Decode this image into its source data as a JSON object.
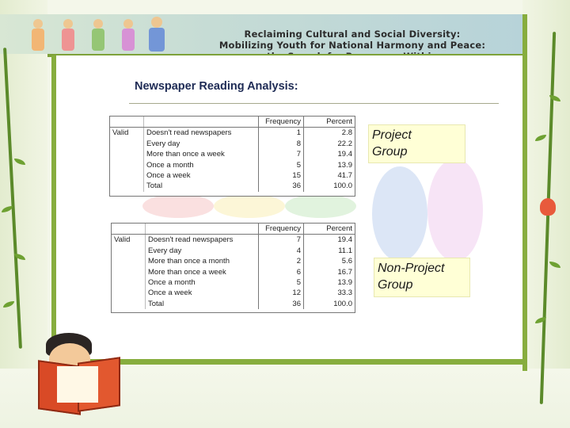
{
  "banner": {
    "line1": "Reclaiming Cultural and Social Diversity:",
    "line2": "Mobilizing Youth for National Harmony and Peace:",
    "line3": "the Search for Resources Within"
  },
  "page_title": "Newspaper Reading Analysis:",
  "project": {
    "label_line1": "Project",
    "label_line2": "Group",
    "columns": [
      "Frequency",
      "Percent"
    ],
    "row_header": "Valid",
    "rows": [
      {
        "label": "Doesn't read newspapers",
        "freq": "1",
        "pct": "2.8"
      },
      {
        "label": "Every day",
        "freq": "8",
        "pct": "22.2"
      },
      {
        "label": "More than once a week",
        "freq": "7",
        "pct": "19.4"
      },
      {
        "label": "Once a month",
        "freq": "5",
        "pct": "13.9"
      },
      {
        "label": "Once a week",
        "freq": "15",
        "pct": "41.7"
      },
      {
        "label": "Total",
        "freq": "36",
        "pct": "100.0"
      }
    ]
  },
  "non_project": {
    "label_line1": "Non-Project",
    "label_line2": "Group",
    "columns": [
      "Frequency",
      "Percent"
    ],
    "row_header": "Valid",
    "rows": [
      {
        "label": "Doesn't read newspapers",
        "freq": "7",
        "pct": "19.4"
      },
      {
        "label": "Every day",
        "freq": "4",
        "pct": "11.1"
      },
      {
        "label": "More than once a month",
        "freq": "2",
        "pct": "5.6"
      },
      {
        "label": "More than once a week",
        "freq": "6",
        "pct": "16.7"
      },
      {
        "label": "Once a month",
        "freq": "5",
        "pct": "13.9"
      },
      {
        "label": "Once a week",
        "freq": "12",
        "pct": "33.3"
      },
      {
        "label": "Total",
        "freq": "36",
        "pct": "100.0"
      }
    ]
  }
}
